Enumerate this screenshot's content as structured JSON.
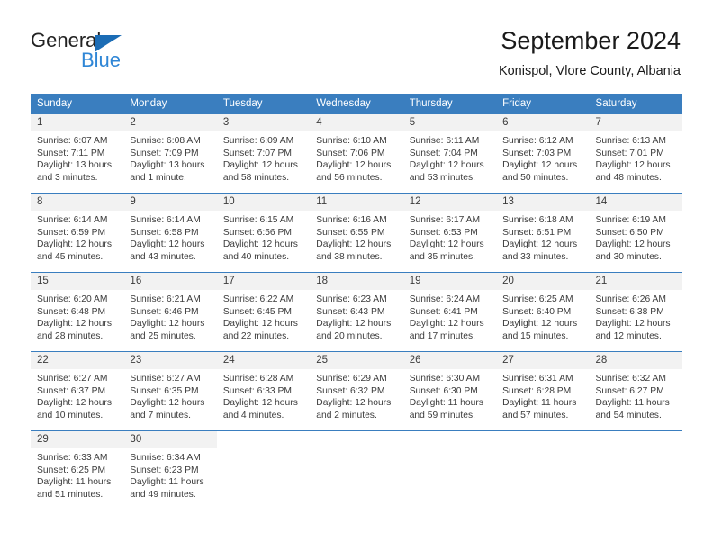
{
  "brand": {
    "name_top": "General",
    "name_bottom": "Blue",
    "flag_icon": "triangle-flag-icon",
    "accent_color": "#1b6cb5",
    "accent_color_light": "#2f86d6"
  },
  "header": {
    "title": "September 2024",
    "subtitle": "Konispol, Vlore County, Albania"
  },
  "calendar": {
    "header_color": "#3a7ebf",
    "weekdays": [
      "Sunday",
      "Monday",
      "Tuesday",
      "Wednesday",
      "Thursday",
      "Friday",
      "Saturday"
    ],
    "weeks": [
      [
        {
          "day": "1",
          "sunrise": "Sunrise: 6:07 AM",
          "sunset": "Sunset: 7:11 PM",
          "daylight_1": "Daylight: 13 hours",
          "daylight_2": "and 3 minutes."
        },
        {
          "day": "2",
          "sunrise": "Sunrise: 6:08 AM",
          "sunset": "Sunset: 7:09 PM",
          "daylight_1": "Daylight: 13 hours",
          "daylight_2": "and 1 minute."
        },
        {
          "day": "3",
          "sunrise": "Sunrise: 6:09 AM",
          "sunset": "Sunset: 7:07 PM",
          "daylight_1": "Daylight: 12 hours",
          "daylight_2": "and 58 minutes."
        },
        {
          "day": "4",
          "sunrise": "Sunrise: 6:10 AM",
          "sunset": "Sunset: 7:06 PM",
          "daylight_1": "Daylight: 12 hours",
          "daylight_2": "and 56 minutes."
        },
        {
          "day": "5",
          "sunrise": "Sunrise: 6:11 AM",
          "sunset": "Sunset: 7:04 PM",
          "daylight_1": "Daylight: 12 hours",
          "daylight_2": "and 53 minutes."
        },
        {
          "day": "6",
          "sunrise": "Sunrise: 6:12 AM",
          "sunset": "Sunset: 7:03 PM",
          "daylight_1": "Daylight: 12 hours",
          "daylight_2": "and 50 minutes."
        },
        {
          "day": "7",
          "sunrise": "Sunrise: 6:13 AM",
          "sunset": "Sunset: 7:01 PM",
          "daylight_1": "Daylight: 12 hours",
          "daylight_2": "and 48 minutes."
        }
      ],
      [
        {
          "day": "8",
          "sunrise": "Sunrise: 6:14 AM",
          "sunset": "Sunset: 6:59 PM",
          "daylight_1": "Daylight: 12 hours",
          "daylight_2": "and 45 minutes."
        },
        {
          "day": "9",
          "sunrise": "Sunrise: 6:14 AM",
          "sunset": "Sunset: 6:58 PM",
          "daylight_1": "Daylight: 12 hours",
          "daylight_2": "and 43 minutes."
        },
        {
          "day": "10",
          "sunrise": "Sunrise: 6:15 AM",
          "sunset": "Sunset: 6:56 PM",
          "daylight_1": "Daylight: 12 hours",
          "daylight_2": "and 40 minutes."
        },
        {
          "day": "11",
          "sunrise": "Sunrise: 6:16 AM",
          "sunset": "Sunset: 6:55 PM",
          "daylight_1": "Daylight: 12 hours",
          "daylight_2": "and 38 minutes."
        },
        {
          "day": "12",
          "sunrise": "Sunrise: 6:17 AM",
          "sunset": "Sunset: 6:53 PM",
          "daylight_1": "Daylight: 12 hours",
          "daylight_2": "and 35 minutes."
        },
        {
          "day": "13",
          "sunrise": "Sunrise: 6:18 AM",
          "sunset": "Sunset: 6:51 PM",
          "daylight_1": "Daylight: 12 hours",
          "daylight_2": "and 33 minutes."
        },
        {
          "day": "14",
          "sunrise": "Sunrise: 6:19 AM",
          "sunset": "Sunset: 6:50 PM",
          "daylight_1": "Daylight: 12 hours",
          "daylight_2": "and 30 minutes."
        }
      ],
      [
        {
          "day": "15",
          "sunrise": "Sunrise: 6:20 AM",
          "sunset": "Sunset: 6:48 PM",
          "daylight_1": "Daylight: 12 hours",
          "daylight_2": "and 28 minutes."
        },
        {
          "day": "16",
          "sunrise": "Sunrise: 6:21 AM",
          "sunset": "Sunset: 6:46 PM",
          "daylight_1": "Daylight: 12 hours",
          "daylight_2": "and 25 minutes."
        },
        {
          "day": "17",
          "sunrise": "Sunrise: 6:22 AM",
          "sunset": "Sunset: 6:45 PM",
          "daylight_1": "Daylight: 12 hours",
          "daylight_2": "and 22 minutes."
        },
        {
          "day": "18",
          "sunrise": "Sunrise: 6:23 AM",
          "sunset": "Sunset: 6:43 PM",
          "daylight_1": "Daylight: 12 hours",
          "daylight_2": "and 20 minutes."
        },
        {
          "day": "19",
          "sunrise": "Sunrise: 6:24 AM",
          "sunset": "Sunset: 6:41 PM",
          "daylight_1": "Daylight: 12 hours",
          "daylight_2": "and 17 minutes."
        },
        {
          "day": "20",
          "sunrise": "Sunrise: 6:25 AM",
          "sunset": "Sunset: 6:40 PM",
          "daylight_1": "Daylight: 12 hours",
          "daylight_2": "and 15 minutes."
        },
        {
          "day": "21",
          "sunrise": "Sunrise: 6:26 AM",
          "sunset": "Sunset: 6:38 PM",
          "daylight_1": "Daylight: 12 hours",
          "daylight_2": "and 12 minutes."
        }
      ],
      [
        {
          "day": "22",
          "sunrise": "Sunrise: 6:27 AM",
          "sunset": "Sunset: 6:37 PM",
          "daylight_1": "Daylight: 12 hours",
          "daylight_2": "and 10 minutes."
        },
        {
          "day": "23",
          "sunrise": "Sunrise: 6:27 AM",
          "sunset": "Sunset: 6:35 PM",
          "daylight_1": "Daylight: 12 hours",
          "daylight_2": "and 7 minutes."
        },
        {
          "day": "24",
          "sunrise": "Sunrise: 6:28 AM",
          "sunset": "Sunset: 6:33 PM",
          "daylight_1": "Daylight: 12 hours",
          "daylight_2": "and 4 minutes."
        },
        {
          "day": "25",
          "sunrise": "Sunrise: 6:29 AM",
          "sunset": "Sunset: 6:32 PM",
          "daylight_1": "Daylight: 12 hours",
          "daylight_2": "and 2 minutes."
        },
        {
          "day": "26",
          "sunrise": "Sunrise: 6:30 AM",
          "sunset": "Sunset: 6:30 PM",
          "daylight_1": "Daylight: 11 hours",
          "daylight_2": "and 59 minutes."
        },
        {
          "day": "27",
          "sunrise": "Sunrise: 6:31 AM",
          "sunset": "Sunset: 6:28 PM",
          "daylight_1": "Daylight: 11 hours",
          "daylight_2": "and 57 minutes."
        },
        {
          "day": "28",
          "sunrise": "Sunrise: 6:32 AM",
          "sunset": "Sunset: 6:27 PM",
          "daylight_1": "Daylight: 11 hours",
          "daylight_2": "and 54 minutes."
        }
      ],
      [
        {
          "day": "29",
          "sunrise": "Sunrise: 6:33 AM",
          "sunset": "Sunset: 6:25 PM",
          "daylight_1": "Daylight: 11 hours",
          "daylight_2": "and 51 minutes."
        },
        {
          "day": "30",
          "sunrise": "Sunrise: 6:34 AM",
          "sunset": "Sunset: 6:23 PM",
          "daylight_1": "Daylight: 11 hours",
          "daylight_2": "and 49 minutes."
        },
        {
          "day": "",
          "sunrise": "",
          "sunset": "",
          "daylight_1": "",
          "daylight_2": ""
        },
        {
          "day": "",
          "sunrise": "",
          "sunset": "",
          "daylight_1": "",
          "daylight_2": ""
        },
        {
          "day": "",
          "sunrise": "",
          "sunset": "",
          "daylight_1": "",
          "daylight_2": ""
        },
        {
          "day": "",
          "sunrise": "",
          "sunset": "",
          "daylight_1": "",
          "daylight_2": ""
        },
        {
          "day": "",
          "sunrise": "",
          "sunset": "",
          "daylight_1": "",
          "daylight_2": ""
        }
      ]
    ]
  }
}
